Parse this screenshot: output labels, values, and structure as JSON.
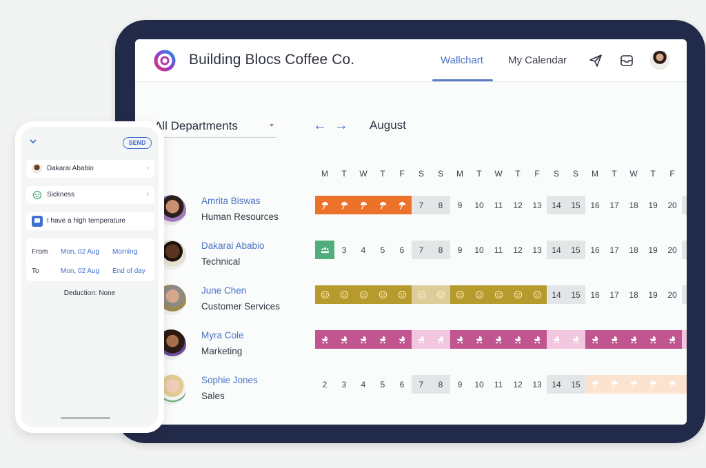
{
  "app": {
    "brand": "Building Blocs Coffee Co.",
    "tabs": [
      {
        "label": "Wallchart",
        "active": true
      },
      {
        "label": "My Calendar",
        "active": false
      }
    ],
    "icons": [
      "send-icon",
      "inbox-icon",
      "user-avatar"
    ]
  },
  "toolbar": {
    "department": "All Departments",
    "prev_icon": "arrow-left-icon",
    "next_icon": "arrow-right-icon",
    "month": "August"
  },
  "calendar": {
    "weekdays": [
      "M",
      "T",
      "W",
      "T",
      "F",
      "S",
      "S",
      "M",
      "T",
      "W",
      "T",
      "F",
      "S",
      "S",
      "M",
      "T",
      "W",
      "T",
      "F"
    ],
    "dates": [
      2,
      3,
      4,
      5,
      6,
      7,
      8,
      9,
      10,
      11,
      12,
      13,
      14,
      15,
      16,
      17,
      18,
      19,
      20
    ],
    "weekend_indices": [
      5,
      6,
      12,
      13
    ],
    "leave_colors": {
      "holiday": "#ec7229",
      "holiday_light": "#fbe3cf",
      "meeting": "#4fae7c",
      "sickness": "#b79a2e",
      "sickness_light": "#dccd99",
      "parental": "#c0558f",
      "parental_light": "#f2c6de"
    },
    "people": [
      {
        "name": "Amrita Biswas",
        "department": "Human Resources",
        "leave": {
          "type": "holiday",
          "days": [
            0,
            1,
            2,
            3,
            4
          ]
        }
      },
      {
        "name": "Dakarai Ababio",
        "department": "Technical",
        "leave": {
          "type": "meeting",
          "days": [
            0
          ]
        }
      },
      {
        "name": "June Chen",
        "department": "Customer Services",
        "leave": {
          "type": "sickness",
          "days": [
            0,
            1,
            2,
            3,
            4,
            5,
            6,
            7,
            8,
            9,
            10,
            11
          ]
        }
      },
      {
        "name": "Myra Cole",
        "department": "Marketing",
        "leave": {
          "type": "parental",
          "days": [
            0,
            1,
            2,
            3,
            4,
            5,
            6,
            7,
            8,
            9,
            10,
            11,
            12,
            13,
            14,
            15,
            16,
            17,
            18
          ]
        }
      },
      {
        "name": "Sophie Jones",
        "department": "Sales",
        "leave": {
          "type": "holiday_light",
          "days": [
            14,
            15,
            16,
            17,
            18
          ]
        }
      }
    ]
  },
  "phone": {
    "collapse_icon": "chevron-down-icon",
    "send_label": "SEND",
    "employee": "Dakarai Ababio",
    "leave_type": "Sickness",
    "note": "I have a high temperature",
    "from_label": "From",
    "from_date": "Mon, 02 Aug",
    "from_time": "Morning",
    "to_label": "To",
    "to_date": "Mon, 02 Aug",
    "to_time": "End of day",
    "deduction": "Deduction: None"
  }
}
